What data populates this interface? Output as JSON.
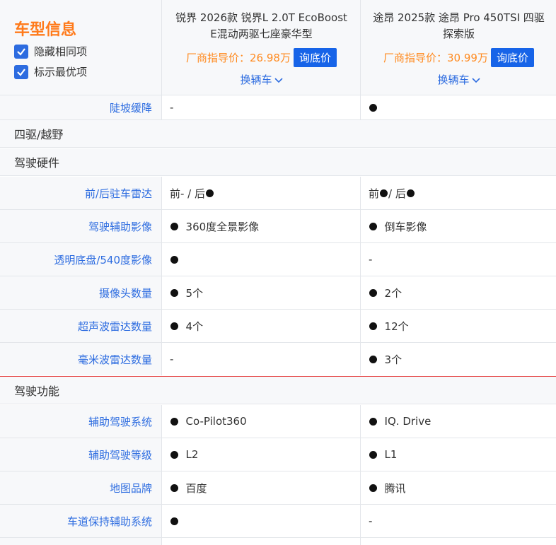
{
  "header": {
    "title": "车型信息",
    "options": [
      {
        "label": "隐藏相同项",
        "checked": true
      },
      {
        "label": "标示最优项",
        "checked": true
      }
    ]
  },
  "cars": [
    {
      "name": "锐界 2026款 锐界L 2.0T EcoBoost E混动两驱七座豪华型",
      "price": "厂商指导价：26.98万",
      "ask_label": "询底价",
      "change_label": "换辆车"
    },
    {
      "name": "途昂 2025款 途昂 Pro 450TSI 四驱探索版",
      "price": "厂商指导价：30.99万",
      "ask_label": "询底价",
      "change_label": "换辆车"
    }
  ],
  "top_row": {
    "label": "陡坡缓降",
    "v1": "-",
    "v2": ""
  },
  "sections": [
    {
      "title": "四驱/越野"
    },
    {
      "title": "驾驶硬件"
    },
    {
      "title": "驾驶功能"
    }
  ],
  "hardware_rows": [
    {
      "label": "前/后驻车雷达",
      "v1_a": "前- / 后",
      "v2_a": "前",
      "v2_b": " / 后"
    },
    {
      "label": "驾驶辅助影像",
      "v1": "360度全景影像",
      "v2": "倒车影像"
    },
    {
      "label": "透明底盘/540度影像",
      "v1": "",
      "v2": "-"
    },
    {
      "label": "摄像头数量",
      "v1": "5个",
      "v2": "2个"
    },
    {
      "label": "超声波雷达数量",
      "v1": "4个",
      "v2": "12个"
    },
    {
      "label": "毫米波雷达数量",
      "v1": "-",
      "v2": "3个"
    }
  ],
  "function_rows": [
    {
      "label": "辅助驾驶系统",
      "v1": "Co-Pilot360",
      "v2": "IQ. Drive"
    },
    {
      "label": "辅助驾驶等级",
      "v1": "L2",
      "v2": "L1"
    },
    {
      "label": "地图品牌",
      "v1": "百度",
      "v2": "腾讯"
    },
    {
      "label": "车道保持辅助系统",
      "v1": "",
      "v2": "-"
    }
  ],
  "colors": {
    "accent": "#ff7a1a",
    "link": "#2d6ce0",
    "button": "#1764e8",
    "price": "#ff8a1f"
  }
}
